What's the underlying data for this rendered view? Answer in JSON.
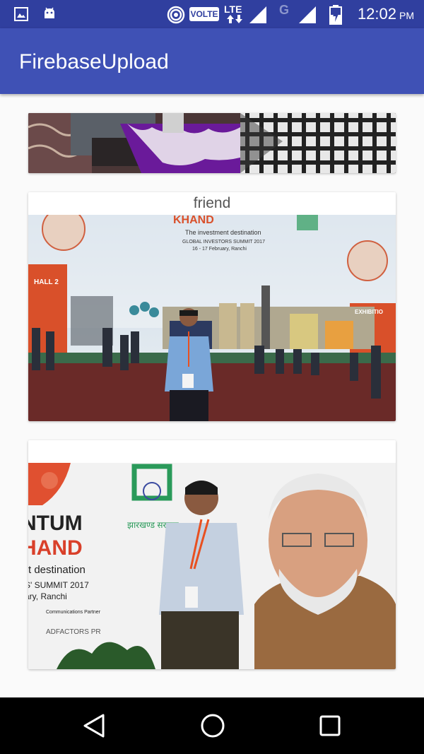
{
  "status_bar": {
    "network_label": "VOLTE",
    "lte_label": "LTE",
    "g_label": "G",
    "time": "12:02",
    "ampm": "PM"
  },
  "app_bar": {
    "title": "FirebaseUpload"
  },
  "cards": [
    {
      "title": ""
    },
    {
      "title": "friend"
    },
    {
      "title": ""
    }
  ],
  "nav": {
    "back": "back-icon",
    "home": "home-icon",
    "recents": "recents-icon"
  }
}
